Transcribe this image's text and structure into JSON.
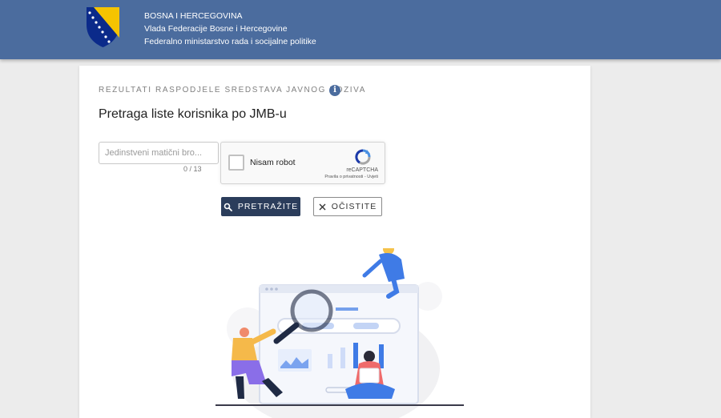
{
  "header": {
    "country": "BOSNA I HERCEGOVINA",
    "government": "Vlada Federacije Bosne i Hercegovine",
    "ministry": "Federalno ministarstvo rada i socijalne politike",
    "emblem_icon": "coat-of-arms-icon"
  },
  "card": {
    "overline": "REZULTATI RASPODJELE SREDSTAVA JAVNOG POZIVA",
    "info_icon": "info-icon",
    "title": "Pretraga liste korisnika po JMB-u"
  },
  "form": {
    "jmb_placeholder": "Jedinstveni matični bro...",
    "jmb_value": "",
    "counter": "0 / 13"
  },
  "captcha": {
    "label": "Nisam robot",
    "brand": "reCAPTCHA",
    "links": "Pravila o privatnosti - Uvjeti"
  },
  "buttons": {
    "search": "PRETRAŽITE",
    "search_icon": "search-icon",
    "clear": "OČISTITE",
    "clear_icon": "close-icon"
  },
  "colors": {
    "header_bg": "#4b6c9e",
    "primary_button": "#2b3d5b",
    "page_bg": "#ececec",
    "illustration_accent": "#3f7be6"
  }
}
